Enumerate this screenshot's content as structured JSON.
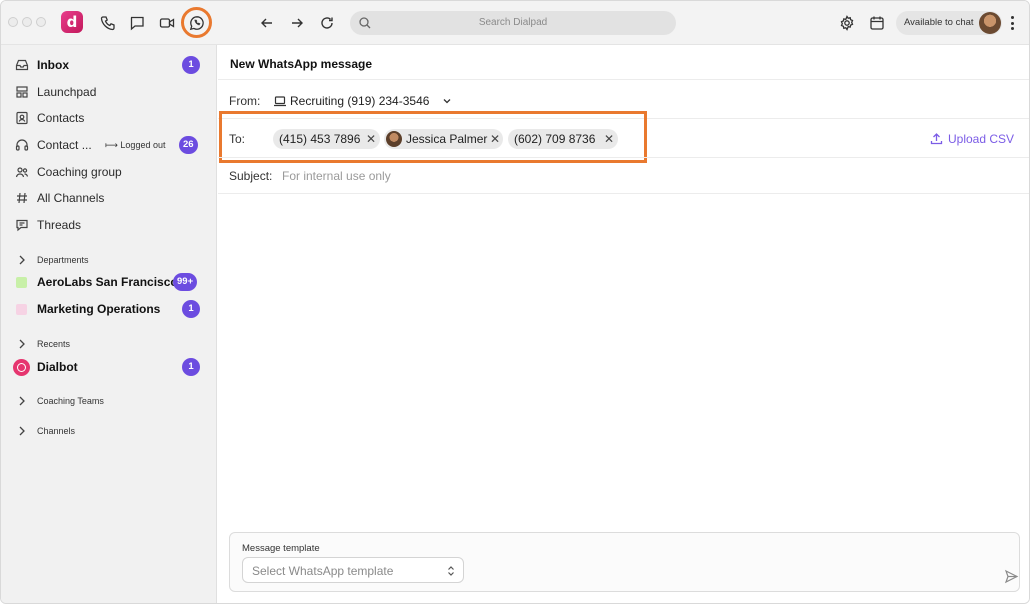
{
  "topbar": {
    "logo_letter": "d",
    "search_placeholder": "Search Dialpad",
    "status": "Available to chat",
    "icons": [
      "phone-icon",
      "chat-icon",
      "video-icon",
      "whatsapp-icon",
      "back-icon",
      "forward-icon",
      "refresh-icon",
      "search-icon",
      "settings-icon",
      "calendar-icon"
    ]
  },
  "sidebar": {
    "items": [
      {
        "label": "Inbox",
        "badge": "1",
        "icon": "inbox-icon"
      },
      {
        "label": "Launchpad",
        "icon": "launchpad-icon"
      },
      {
        "label": "Contacts",
        "icon": "contacts-icon"
      },
      {
        "label": "Contact ...",
        "status": "Logged out",
        "badge": "26",
        "icon": "headset-icon"
      },
      {
        "label": "Coaching group",
        "icon": "group-icon"
      },
      {
        "label": "All Channels",
        "icon": "hash-icon"
      },
      {
        "label": "Threads",
        "icon": "threads-icon"
      }
    ],
    "departments_header": "Departments",
    "departments": [
      {
        "label": "AeroLabs San Francisco ...",
        "badge": "99+",
        "color": "#c8f0a8"
      },
      {
        "label": "Marketing Operations",
        "badge": "1",
        "color": "#f6d3e4"
      }
    ],
    "recents_header": "Recents",
    "recents": [
      {
        "label": "Dialbot",
        "badge": "1"
      }
    ],
    "coaching_teams_header": "Coaching Teams",
    "channels_header": "Channels"
  },
  "main": {
    "title": "New WhatsApp message",
    "from_label": "From:",
    "from_value": "Recruiting (919) 234-3546",
    "to_label": "To:",
    "recipients": [
      {
        "text": "(415) 453 7896"
      },
      {
        "text": "Jessica Palmer"
      },
      {
        "text": "(602) 709 8736"
      }
    ],
    "upload_label": "Upload CSV",
    "subject_label": "Subject:",
    "subject_placeholder": "For internal use only",
    "template_label": "Message template",
    "template_placeholder": "Select WhatsApp template"
  },
  "colors": {
    "accent": "#6c4ce0",
    "highlight": "#e9792f",
    "link": "#7b5ce6"
  }
}
